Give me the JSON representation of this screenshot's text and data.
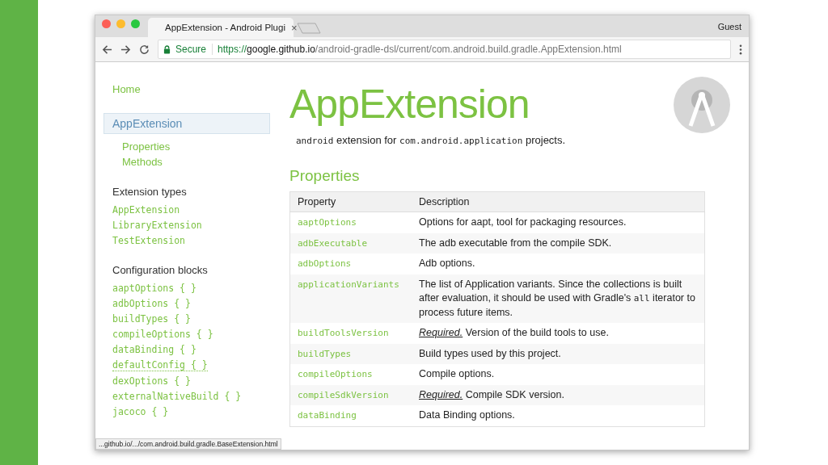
{
  "browser": {
    "tab": {
      "title": "AppExtension - Android Plugi",
      "close": "×",
      "selected": true
    },
    "profile": "Guest",
    "security": "Secure",
    "url": {
      "scheme": "https://",
      "host": "google.github.io",
      "path": "/android-gradle-dsl/current/com.android.build.gradle.AppExtension.html"
    },
    "status_url": "...github.io/.../com.android.build.gradle.BaseExtension.html"
  },
  "sidebar": {
    "home": "Home",
    "current": {
      "label": "AppExtension",
      "selected": true
    },
    "sub_items": [
      "Properties",
      "Methods"
    ],
    "sections": [
      {
        "title": "Extension types",
        "items": [
          {
            "label": "AppExtension",
            "hovered": false
          },
          {
            "label": "LibraryExtension",
            "hovered": false
          },
          {
            "label": "TestExtension",
            "hovered": false
          }
        ]
      },
      {
        "title": "Configuration blocks",
        "items": [
          {
            "label": "aaptOptions { }",
            "hovered": false
          },
          {
            "label": "adbOptions { }",
            "hovered": false
          },
          {
            "label": "buildTypes { }",
            "hovered": false
          },
          {
            "label": "compileOptions { }",
            "hovered": false
          },
          {
            "label": "dataBinding { }",
            "hovered": false
          },
          {
            "label": "defaultConfig { }",
            "hovered": true
          },
          {
            "label": "dexOptions { }",
            "hovered": false
          },
          {
            "label": "externalNativeBuild { }",
            "hovered": false
          },
          {
            "label": "jacoco { }",
            "hovered": false
          }
        ]
      }
    ]
  },
  "main": {
    "title": "AppExtension",
    "intro": [
      {
        "kind": "code",
        "text": "android"
      },
      {
        "kind": "text",
        "text": " extension for "
      },
      {
        "kind": "code",
        "text": "com.android.application"
      },
      {
        "kind": "text",
        "text": " projects."
      }
    ],
    "section_title": "Properties",
    "table": {
      "columns": [
        "Property",
        "Description"
      ],
      "rows": [
        {
          "property": "aaptOptions",
          "description": [
            {
              "kind": "text",
              "text": "Options for aapt, tool for packaging resources."
            }
          ]
        },
        {
          "property": "adbExecutable",
          "description": [
            {
              "kind": "text",
              "text": "The adb executable from the compile SDK."
            }
          ]
        },
        {
          "property": "adbOptions",
          "description": [
            {
              "kind": "text",
              "text": "Adb options."
            }
          ]
        },
        {
          "property": "applicationVariants",
          "description": [
            {
              "kind": "text",
              "text": "The list of Application variants. Since the collections is built after evaluation, it should be used with Gradle's "
            },
            {
              "kind": "code",
              "text": "all"
            },
            {
              "kind": "text",
              "text": " iterator to process future items."
            }
          ]
        },
        {
          "property": "buildToolsVersion",
          "description": [
            {
              "kind": "link",
              "text": "Required."
            },
            {
              "kind": "text",
              "text": " Version of the build tools to use."
            }
          ]
        },
        {
          "property": "buildTypes",
          "description": [
            {
              "kind": "text",
              "text": "Build types used by this project."
            }
          ]
        },
        {
          "property": "compileOptions",
          "description": [
            {
              "kind": "text",
              "text": "Compile options."
            }
          ]
        },
        {
          "property": "compileSdkVersion",
          "description": [
            {
              "kind": "link",
              "text": "Required."
            },
            {
              "kind": "text",
              "text": " Compile SDK version."
            }
          ]
        },
        {
          "property": "dataBinding",
          "description": [
            {
              "kind": "text",
              "text": "Data Binding options."
            }
          ]
        }
      ]
    }
  }
}
